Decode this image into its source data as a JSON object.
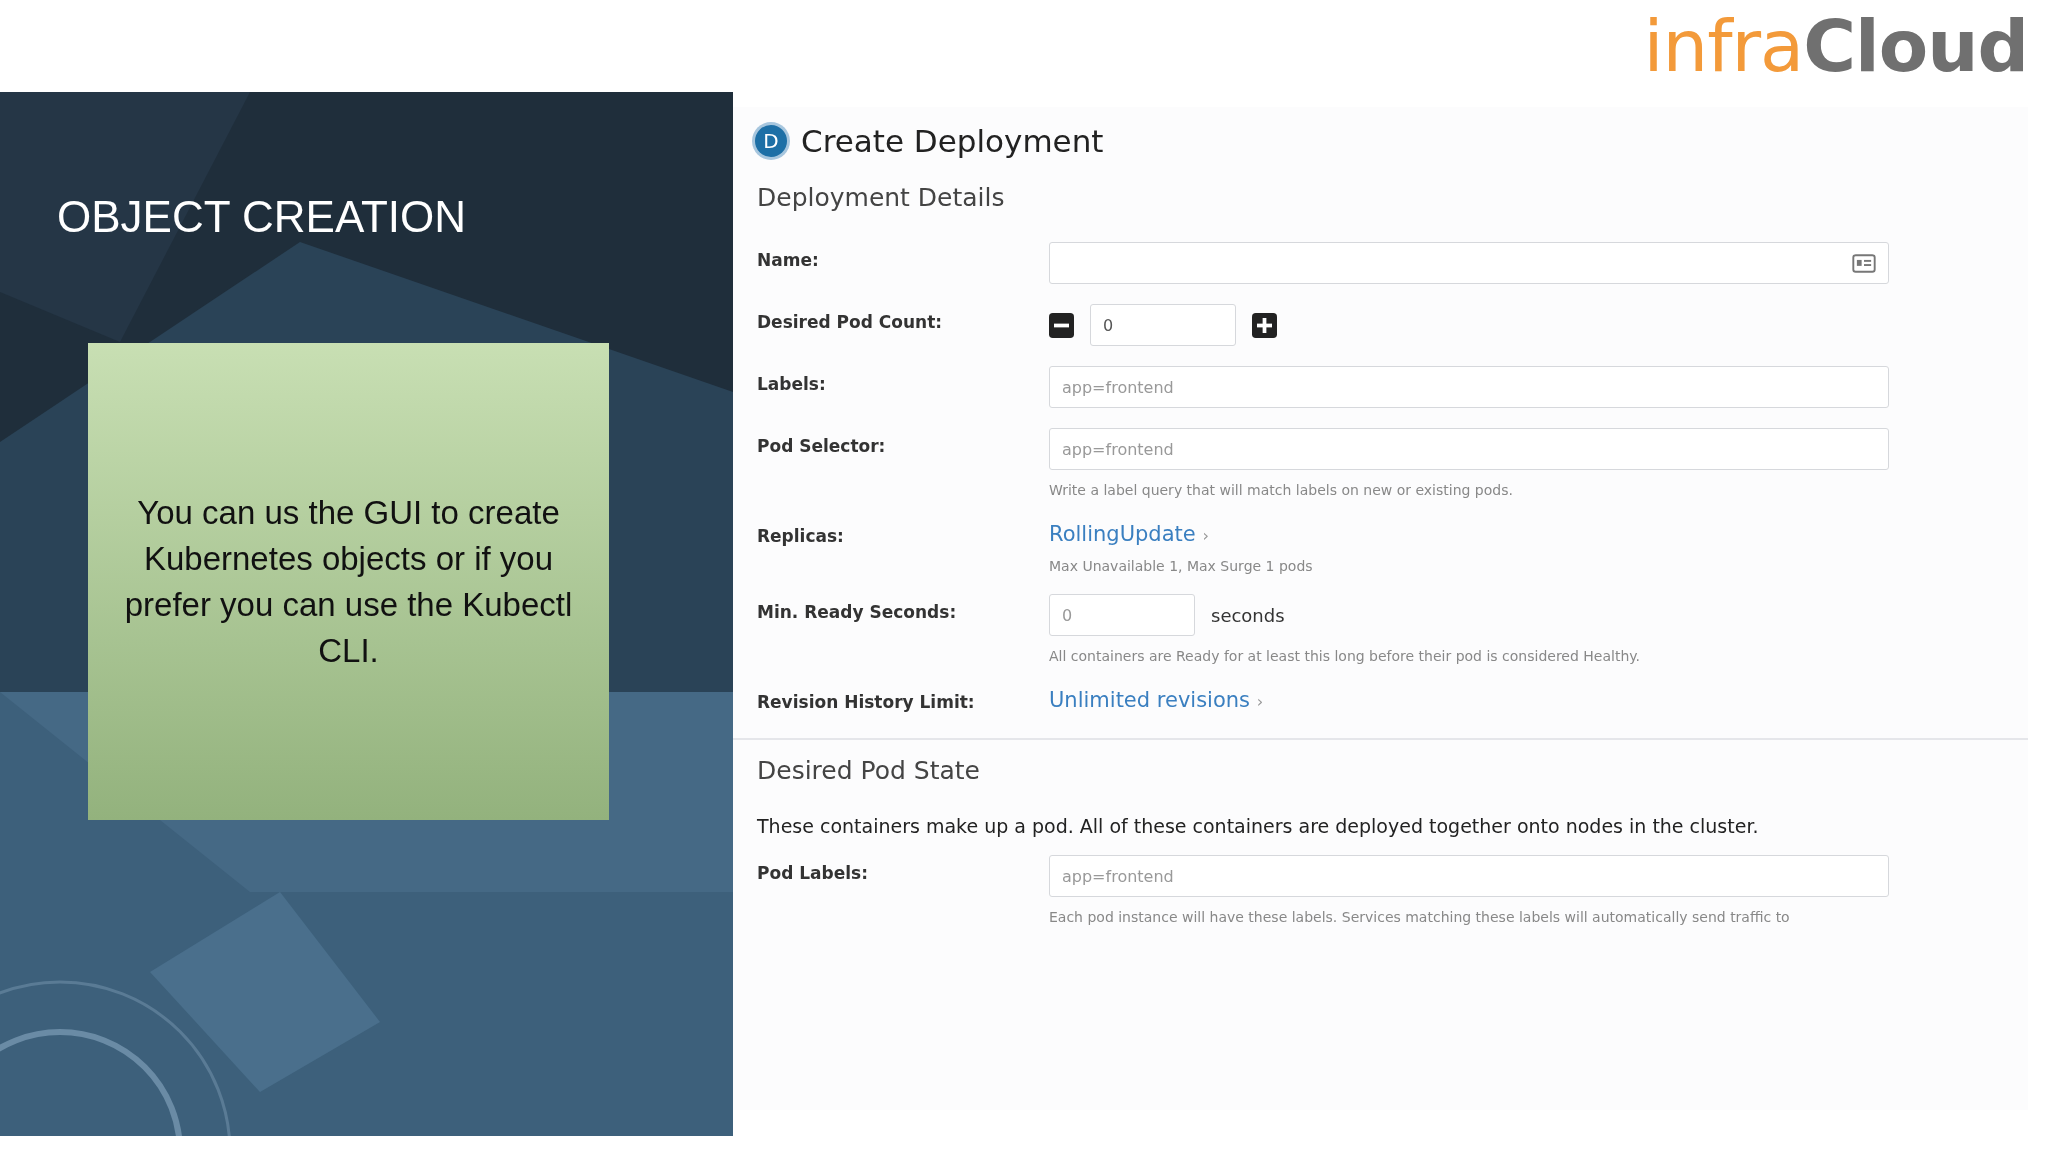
{
  "logo": "infra**Cloud**",
  "slide": {
    "title": "OBJECT CREATION",
    "note": "You can us the GUI to create Kubernetes objects or if you prefer you can use the Kubectl CLI."
  },
  "dialog": {
    "badge": "D",
    "title": "Create Deployment",
    "sections": [
      {
        "heading": "Deployment Details",
        "rows": [
          {
            "kind": "text",
            "label": "Name:"
          },
          {
            "kind": "counter",
            "label": "Desired Pod Count:",
            "value": "0"
          },
          {
            "kind": "input",
            "label": "Labels:",
            "placeholder": "app=frontend"
          },
          {
            "kind": "input",
            "label": "Pod Selector:",
            "placeholder": "app=frontend",
            "hint": "Write a label query that will match labels on new or existing pods."
          },
          {
            "kind": "link",
            "label": "Replicas:",
            "link": "RollingUpdate",
            "arrow": "›",
            "hint": "Max Unavailable 1, Max Surge 1 pods"
          },
          {
            "kind": "seconds",
            "label": "Min. Ready Seconds:",
            "placeholder": "0",
            "unit": "seconds",
            "hint": "All containers are Ready for at least this long before their pod is considered Healthy."
          },
          {
            "kind": "link",
            "label": "Revision History Limit:",
            "link": "Unlimited revisions",
            "arrow": "›"
          }
        ]
      },
      {
        "heading": "Desired Pod State",
        "intro": "These containers make up a pod. All of these containers are deployed together onto nodes in the cluster.",
        "rows": [
          {
            "kind": "input",
            "label": "Pod Labels:",
            "placeholder": "app=frontend",
            "hint": "Each pod instance will have these labels. Services matching these labels will automatically send traffic to"
          }
        ]
      }
    ]
  }
}
